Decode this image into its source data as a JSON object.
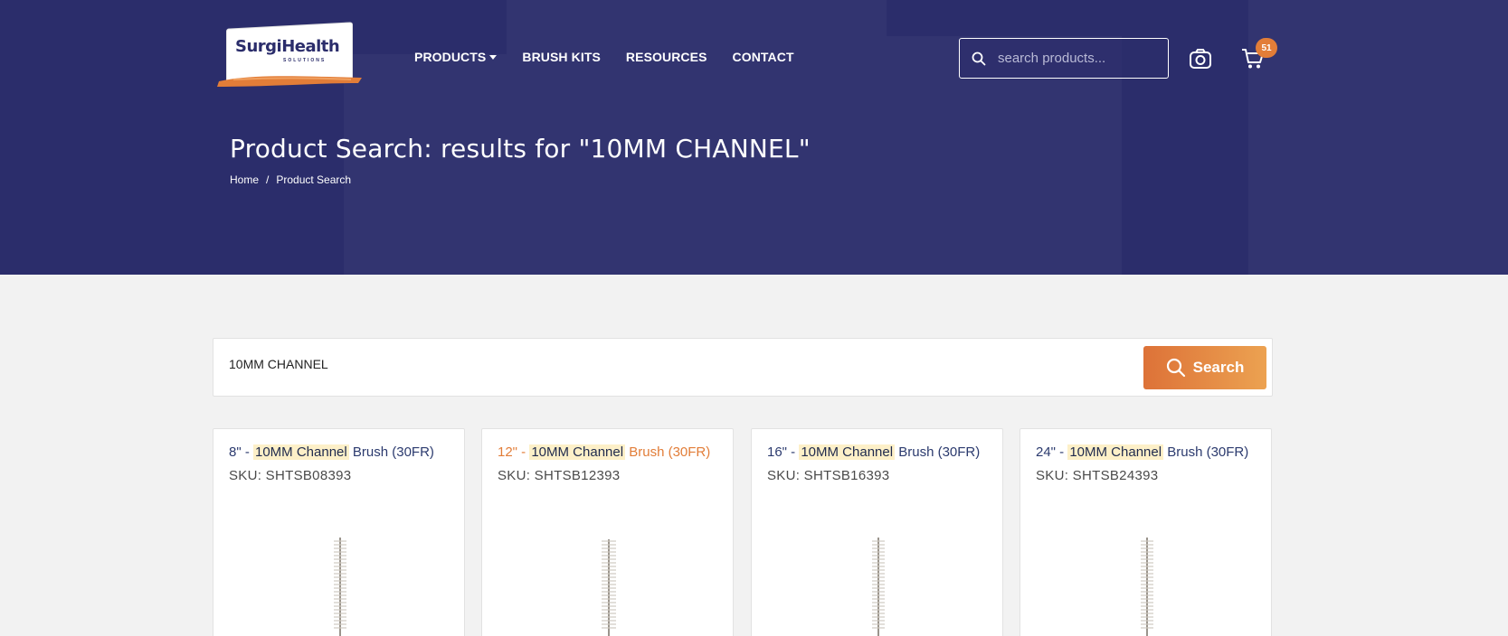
{
  "header": {
    "logo": {
      "brand_left": "Surgi",
      "brand_right": "Health",
      "tagline": "SOLUTIONS"
    },
    "nav": [
      {
        "label": "PRODUCTS",
        "has_dropdown": true
      },
      {
        "label": "BRUSH KITS"
      },
      {
        "label": "RESOURCES"
      },
      {
        "label": "CONTACT"
      }
    ],
    "search_placeholder": "search products...",
    "cart_count": "51",
    "icons": {
      "search": "search-icon",
      "camera": "camera-icon",
      "cart": "cart-icon"
    },
    "colors": {
      "hero_bg": "#2b2d6b",
      "accent": "#e27d38"
    }
  },
  "hero": {
    "title": "Product Search: results for \"10MM CHANNEL\"",
    "breadcrumbs": [
      "Home",
      "/",
      "Product Search"
    ]
  },
  "search": {
    "value": "10MM CHANNEL",
    "button_label": "Search"
  },
  "results": [
    {
      "prefix": "8\" - ",
      "highlight": "10MM Channel",
      "suffix": " Brush (30FR)",
      "sku": "SKU: SHTSB08393"
    },
    {
      "prefix": "12\" - ",
      "highlight": "10MM Channel",
      "suffix": " Brush (30FR)",
      "sku": "SKU: SHTSB12393"
    },
    {
      "prefix": "16\" - ",
      "highlight": "10MM Channel",
      "suffix": " Brush (30FR)",
      "sku": "SKU: SHTSB16393"
    },
    {
      "prefix": "24\" - ",
      "highlight": "10MM Channel",
      "suffix": " Brush (30FR)",
      "sku": "SKU: SHTSB24393"
    }
  ]
}
